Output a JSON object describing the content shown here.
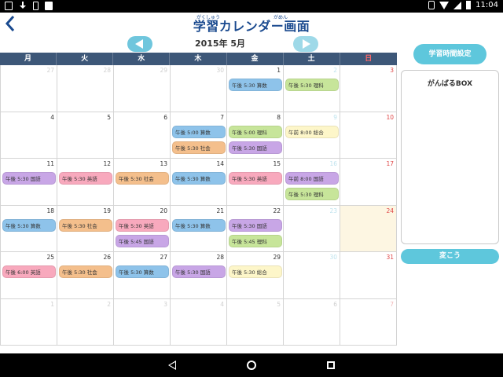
{
  "status_bar": {
    "time": "11:04"
  },
  "header": {
    "title": "学習カレンダー画面",
    "ruby_gakushu": "がくしゅう",
    "ruby_gamen": "がめん"
  },
  "calendar": {
    "month_label": "2015年 5月",
    "weekdays": [
      "月",
      "火",
      "水",
      "木",
      "金",
      "土",
      "日"
    ],
    "weeks": [
      [
        {
          "day": "27",
          "out": true,
          "events": []
        },
        {
          "day": "28",
          "out": true,
          "events": []
        },
        {
          "day": "29",
          "out": true,
          "events": []
        },
        {
          "day": "30",
          "out": true,
          "events": []
        },
        {
          "day": "1",
          "events": [
            {
              "text": "午後 5:30 算数",
              "color": "#8ec3ea"
            }
          ]
        },
        {
          "day": "2",
          "sat": true,
          "events": [
            {
              "text": "午後 5:30 理科",
              "color": "#c7e59a"
            }
          ]
        },
        {
          "day": "3",
          "sun": true,
          "events": []
        }
      ],
      [
        {
          "day": "4",
          "events": []
        },
        {
          "day": "5",
          "events": []
        },
        {
          "day": "6",
          "events": []
        },
        {
          "day": "7",
          "events": [
            {
              "text": "午後 5:00 算数",
              "color": "#8ec3ea"
            },
            {
              "text": "午後 5:30 社会",
              "color": "#f4bf8c"
            }
          ]
        },
        {
          "day": "8",
          "events": [
            {
              "text": "午後 5:00 理科",
              "color": "#c7e59a"
            },
            {
              "text": "午後 5:30 国語",
              "color": "#c8a6e6"
            }
          ]
        },
        {
          "day": "9",
          "sat": true,
          "events": [
            {
              "text": "午前 8:00 総合",
              "color": "#fdf6c9"
            }
          ]
        },
        {
          "day": "10",
          "sun": true,
          "events": []
        }
      ],
      [
        {
          "day": "11",
          "events": [
            {
              "text": "午後 5:30 国語",
              "color": "#c8a6e6"
            }
          ]
        },
        {
          "day": "12",
          "events": [
            {
              "text": "午後 5:30 英語",
              "color": "#f8a9bd"
            }
          ]
        },
        {
          "day": "13",
          "events": [
            {
              "text": "午後 5:30 社会",
              "color": "#f4bf8c"
            }
          ]
        },
        {
          "day": "14",
          "events": [
            {
              "text": "午後 5:30 算数",
              "color": "#8ec3ea"
            }
          ]
        },
        {
          "day": "15",
          "events": [
            {
              "text": "午後 5:30 英語",
              "color": "#f8a9bd"
            }
          ]
        },
        {
          "day": "16",
          "sat": true,
          "events": [
            {
              "text": "午前 8:00 国語",
              "color": "#c8a6e6"
            },
            {
              "text": "午後 5:30 理科",
              "color": "#c7e59a"
            }
          ]
        },
        {
          "day": "17",
          "sun": true,
          "events": []
        }
      ],
      [
        {
          "day": "18",
          "events": [
            {
              "text": "午後 5:30 算数",
              "color": "#8ec3ea"
            }
          ]
        },
        {
          "day": "19",
          "events": [
            {
              "text": "午後 5:30 社会",
              "color": "#f4bf8c"
            }
          ]
        },
        {
          "day": "20",
          "events": [
            {
              "text": "午後 5:30 英語",
              "color": "#f8a9bd"
            },
            {
              "text": "午後 5:45 国語",
              "color": "#c8a6e6"
            }
          ]
        },
        {
          "day": "21",
          "events": [
            {
              "text": "午後 5:30 算数",
              "color": "#8ec3ea"
            }
          ]
        },
        {
          "day": "22",
          "events": [
            {
              "text": "午後 5:30 国語",
              "color": "#c8a6e6"
            },
            {
              "text": "午後 5:45 理科",
              "color": "#c7e59a"
            }
          ]
        },
        {
          "day": "23",
          "sat": true,
          "events": []
        },
        {
          "day": "24",
          "sun": true,
          "today": true,
          "events": []
        }
      ],
      [
        {
          "day": "25",
          "events": [
            {
              "text": "午後 6:00 英語",
              "color": "#f8a9bd"
            }
          ]
        },
        {
          "day": "26",
          "events": [
            {
              "text": "午後 5:30 社会",
              "color": "#f4bf8c"
            }
          ]
        },
        {
          "day": "27",
          "events": [
            {
              "text": "午後 5:30 算数",
              "color": "#8ec3ea"
            }
          ]
        },
        {
          "day": "28",
          "events": [
            {
              "text": "午後 5:30 国語",
              "color": "#c8a6e6"
            }
          ]
        },
        {
          "day": "29",
          "events": [
            {
              "text": "午後 5:30 総合",
              "color": "#fdf6c9"
            }
          ]
        },
        {
          "day": "30",
          "sat": true,
          "events": []
        },
        {
          "day": "31",
          "sun": true,
          "events": []
        }
      ],
      [
        {
          "day": "1",
          "out": true,
          "events": []
        },
        {
          "day": "2",
          "out": true,
          "events": []
        },
        {
          "day": "3",
          "out": true,
          "events": []
        },
        {
          "day": "4",
          "out": true,
          "events": []
        },
        {
          "day": "5",
          "out": true,
          "events": []
        },
        {
          "day": "6",
          "out": true,
          "sat": true,
          "events": []
        },
        {
          "day": "7",
          "out": true,
          "sun": true,
          "events": []
        }
      ]
    ]
  },
  "side_panel": {
    "study_time_button": "学習時間設定",
    "box_title": "がんばるBOX",
    "change_button": "変こう"
  },
  "colors": {
    "accent": "#5ec7dc",
    "header_bar": "#3d5778",
    "title": "#1a4a8f"
  }
}
